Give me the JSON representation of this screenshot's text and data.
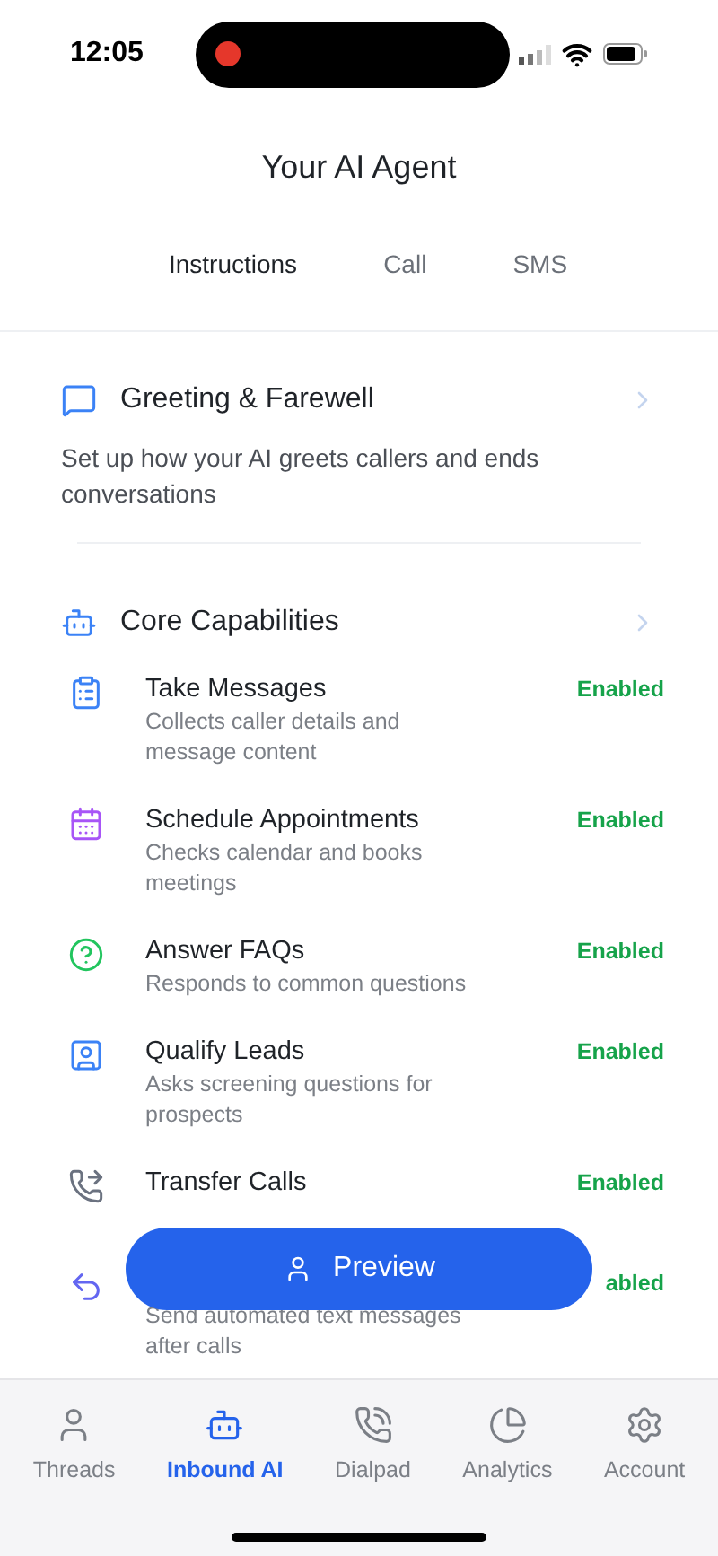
{
  "status_bar": {
    "time": "12:05"
  },
  "header": {
    "title": "Your AI Agent"
  },
  "tabs": [
    {
      "label": "Instructions",
      "selected": true
    },
    {
      "label": "Call",
      "selected": false
    },
    {
      "label": "SMS",
      "selected": false
    }
  ],
  "greeting": {
    "title": "Greeting & Farewell",
    "description": "Set up how your AI greets callers and ends conversations"
  },
  "core": {
    "title": "Core Capabilities",
    "items": [
      {
        "kind": "messages",
        "title": "Take Messages",
        "description": "Collects caller details and message content",
        "status": "Enabled"
      },
      {
        "kind": "appointments",
        "title": "Schedule Appointments",
        "description": "Checks calendar and books meetings",
        "status": "Enabled"
      },
      {
        "kind": "faqs",
        "title": "Answer FAQs",
        "description": "Responds to common questions",
        "status": "Enabled"
      },
      {
        "kind": "leads",
        "title": "Qualify Leads",
        "description": "Asks screening questions for prospects",
        "status": "Enabled"
      },
      {
        "kind": "transfer",
        "title": "Transfer Calls",
        "status": "Enabled"
      },
      {
        "kind": "sms",
        "description": "Send automated text messages after calls",
        "status": "abled"
      }
    ]
  },
  "preview_button": {
    "label": "Preview"
  },
  "nav": [
    {
      "kind": "threads",
      "label": "Threads",
      "selected": false
    },
    {
      "kind": "inbound",
      "label": "Inbound AI",
      "selected": true
    },
    {
      "kind": "dialpad",
      "label": "Dialpad",
      "selected": false
    },
    {
      "kind": "analytics",
      "label": "Analytics",
      "selected": false
    },
    {
      "kind": "account",
      "label": "Account",
      "selected": false
    }
  ]
}
